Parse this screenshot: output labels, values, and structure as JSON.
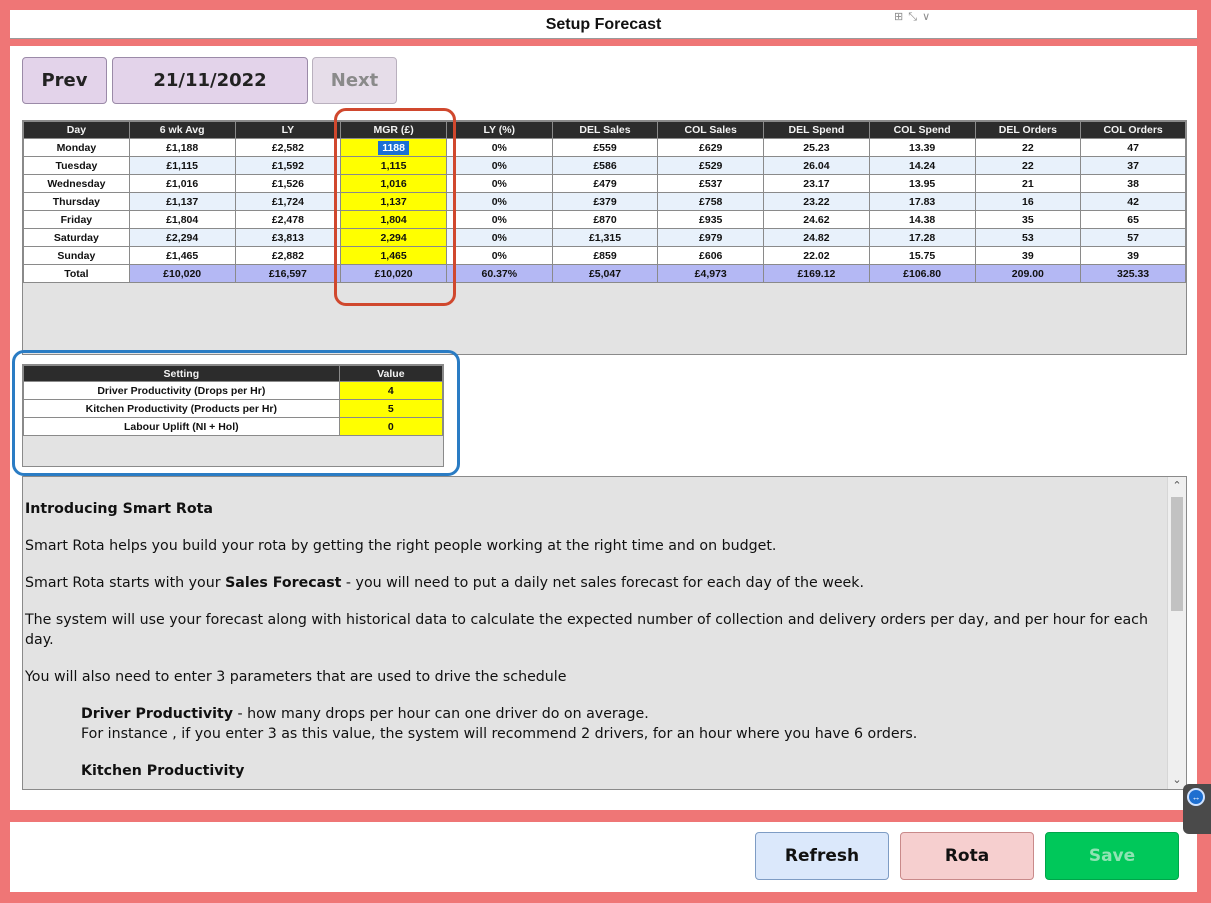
{
  "window": {
    "title": "Setup Forecast",
    "window_controls": "⊞ ⤡ ∨"
  },
  "nav": {
    "prev_label": "Prev",
    "date": "21/11/2022",
    "next_label": "Next"
  },
  "forecast_table": {
    "columns": [
      "Day",
      "6 wk Avg",
      "LY",
      "MGR (£)",
      "LY (%)",
      "DEL Sales",
      "COL Sales",
      "DEL Spend",
      "COL Spend",
      "DEL Orders",
      "COL Orders"
    ],
    "rows": [
      [
        "Monday",
        "£1,188",
        "£2,582",
        "1188",
        "0%",
        "£559",
        "£629",
        "25.23",
        "13.39",
        "22",
        "47"
      ],
      [
        "Tuesday",
        "£1,115",
        "£1,592",
        "1,115",
        "0%",
        "£586",
        "£529",
        "26.04",
        "14.24",
        "22",
        "37"
      ],
      [
        "Wednesday",
        "£1,016",
        "£1,526",
        "1,016",
        "0%",
        "£479",
        "£537",
        "23.17",
        "13.95",
        "21",
        "38"
      ],
      [
        "Thursday",
        "£1,137",
        "£1,724",
        "1,137",
        "0%",
        "£379",
        "£758",
        "23.22",
        "17.83",
        "16",
        "42"
      ],
      [
        "Friday",
        "£1,804",
        "£2,478",
        "1,804",
        "0%",
        "£870",
        "£935",
        "24.62",
        "14.38",
        "35",
        "65"
      ],
      [
        "Saturday",
        "£2,294",
        "£3,813",
        "2,294",
        "0%",
        "£1,315",
        "£979",
        "24.82",
        "17.28",
        "53",
        "57"
      ],
      [
        "Sunday",
        "£1,465",
        "£2,882",
        "1,465",
        "0%",
        "£859",
        "£606",
        "22.02",
        "15.75",
        "39",
        "39"
      ]
    ],
    "total": [
      "Total",
      "£10,020",
      "£16,597",
      "£10,020",
      "60.37%",
      "£5,047",
      "£4,973",
      "£169.12",
      "£106.80",
      "209.00",
      "325.33"
    ]
  },
  "settings_table": {
    "columns": [
      "Setting",
      "Value"
    ],
    "rows": [
      [
        "Driver Productivity (Drops per Hr)",
        "4"
      ],
      [
        "Kitchen Productivity (Products per Hr)",
        "5"
      ],
      [
        "Labour Uplift (NI + Hol)",
        "0"
      ]
    ]
  },
  "info": {
    "heading": "Introducing Smart Rota",
    "p1": "Smart Rota helps you build your rota by getting the right people working at the right time and on budget.",
    "p2_pre": "Smart Rota starts with your ",
    "p2_bold": "Sales Forecast",
    "p2_post": " - you will need to put a daily net sales forecast for each day of the week.",
    "p3": "The system will use your forecast along with historical data to calculate the expected number of collection and delivery orders per day, and per hour for each day.",
    "p4": "You will also need to enter 3 parameters that are used to drive the schedule",
    "driver_bold": "Driver Productivity",
    "driver_text": " - how many drops per hour can one driver do on average.",
    "driver_example": "For instance , if you enter 3 as this value, the system will recommend 2 drivers, for an hour where you have 6 orders.",
    "kitchen_bold": "Kitchen Productivity"
  },
  "actions": {
    "refresh_label": "Refresh",
    "rota_label": "Rota",
    "save_label": "Save"
  },
  "colors": {
    "frame": "#ef7676",
    "mgr_input": "#ffff00",
    "total_row": "#b4b8f4",
    "highlight_red": "#d0482e",
    "highlight_blue": "#2a7cc4"
  }
}
